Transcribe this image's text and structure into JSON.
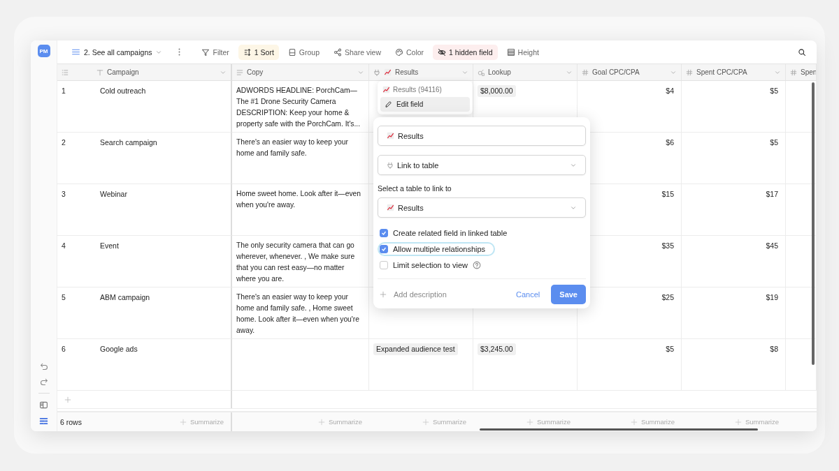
{
  "workspace": {
    "avatar": "PM"
  },
  "toolbar": {
    "view": "2. See all campaigns",
    "items": [
      {
        "kind": "filter",
        "label": "Filter"
      },
      {
        "kind": "sort",
        "label": "1 Sort",
        "color": "#fdf6e6"
      },
      {
        "kind": "group",
        "label": "Group"
      },
      {
        "kind": "share",
        "label": "Share view"
      },
      {
        "kind": "color",
        "label": "Color"
      },
      {
        "kind": "hidden",
        "label": "1 hidden field",
        "color": "#fdeeee"
      },
      {
        "kind": "height",
        "label": "Height"
      }
    ]
  },
  "table": {
    "columns": [
      {
        "kind": "rownum"
      },
      {
        "kind": "text",
        "label": "Campaign"
      },
      {
        "kind": "long_text",
        "label": "Copy"
      },
      {
        "kind": "link",
        "label": "Results"
      },
      {
        "kind": "lookup",
        "label": "Lookup"
      },
      {
        "kind": "number",
        "label": "Goal CPC/CPA"
      },
      {
        "kind": "number",
        "label": "Spent CPC/CPA"
      },
      {
        "kind": "number",
        "label": "Spen"
      }
    ],
    "rows": [
      {
        "num": "1",
        "campaign": "Cold outreach",
        "copy": "ADWORDS HEADLINE: PorchCam—The #1 Drone Security Camera DESCRIPTION: Keep your home & property safe with the PorchCam. It's...",
        "lookup": "$8,000.00",
        "goal": "$4",
        "spent": "$5"
      },
      {
        "num": "2",
        "campaign": "Search campaign",
        "copy": "There's an easier way to keep your home and family safe.",
        "goal": "$6",
        "spent": "$5"
      },
      {
        "num": "3",
        "campaign": "Webinar",
        "copy": "Home sweet home. Look after it—even when you're away.",
        "goal": "$15",
        "spent": "$17"
      },
      {
        "num": "4",
        "campaign": "Event",
        "copy": "The only security camera that can go wherever, whenever. , We make sure that you can rest easy—no matter where you are.",
        "goal": "$35",
        "spent": "$45"
      },
      {
        "num": "5",
        "campaign": "ABM campaign",
        "copy": "There's an easier way to keep your home and family safe. , Home sweet home. Look after it—even when you're away.",
        "goal": "$25",
        "spent": "$19"
      },
      {
        "num": "6",
        "campaign": "Google ads",
        "results": "Expanded audience test",
        "lookup": "$3,245.00",
        "goal": "$5",
        "spent": "$8"
      }
    ],
    "footer": {
      "count": "6 rows",
      "summarize": [
        "Summarize",
        "Summarize",
        "Summarize",
        "Summarize",
        "Summarize",
        "Summarize"
      ]
    }
  },
  "field_menu": {
    "title": "Results (94116)",
    "items": [
      {
        "label": "Edit field",
        "selected": true
      }
    ]
  },
  "edit_dialog": {
    "name": "Results",
    "type": "Link to table",
    "table_label": "Select a table to link to",
    "table": "Results",
    "options": [
      {
        "label": "Create related field in linked table",
        "checked": true,
        "focused": false,
        "help": false
      },
      {
        "label": "Allow multiple relationships",
        "checked": true,
        "focused": true,
        "help": false
      },
      {
        "label": "Limit selection to view",
        "checked": false,
        "focused": false,
        "help": true
      }
    ],
    "add_description": "Add description",
    "cancel": "Cancel",
    "save": "Save"
  }
}
